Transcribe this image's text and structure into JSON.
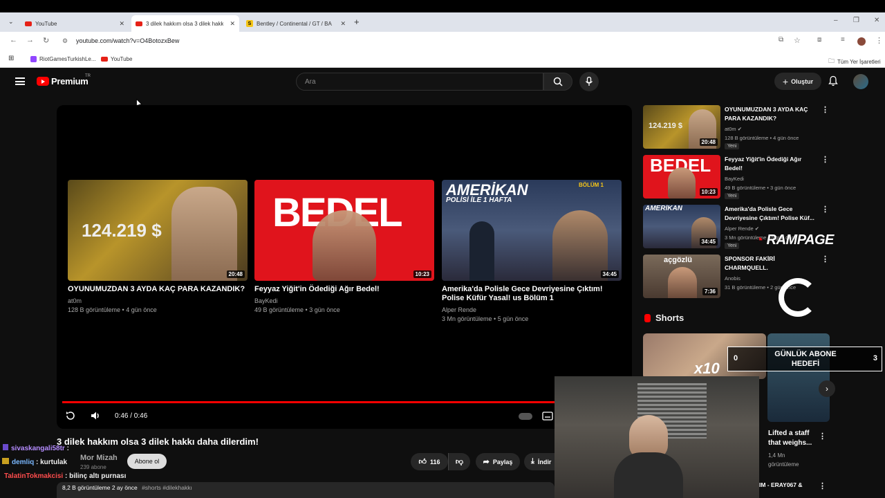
{
  "browser": {
    "tabs": [
      {
        "title": "YouTube"
      },
      {
        "title": "3 dilek hakkım olsa 3 dilek hakkı"
      },
      {
        "title": "Bentley / Continental / GT / BA"
      }
    ],
    "url": "youtube.com/watch?v=O4BotozxBew",
    "bookmarks": [
      "RiotGamesTurkishLe...",
      "YouTube"
    ],
    "all_bookmarks": "Tüm Yer İşaretleri"
  },
  "header": {
    "logo": "Premium",
    "country": "TR",
    "search_placeholder": "Ara",
    "create_label": "Oluştur"
  },
  "player": {
    "time": "0:46 / 0:46",
    "progress_fraction": 1.0,
    "end_cards": [
      {
        "title": "OYUNUMUZDAN 3 AYDA KAÇ PARA KAZANDIK?",
        "channel": "at0m",
        "meta": "128 B görüntüleme • 4 gün önce",
        "duration": "20:48",
        "thumb_text": "124.219 $"
      },
      {
        "title": "Feyyaz Yiğit'in Ödediği Ağır Bedel!",
        "channel": "BayKedi",
        "meta": "49 B görüntüleme • 3 gün önce",
        "duration": "10:23",
        "thumb_text": "BEDEL"
      },
      {
        "title": "Amerika'da Polisle Gece Devriyesine Çıktım! Polise Küfür Yasal! us Bölüm 1",
        "channel": "Alper Rende",
        "meta": "3 Mn görüntüleme • 5 gün önce",
        "duration": "34:45",
        "thumb_text": "AMERİKAN",
        "thumb_sub": "POLİSİ İLE 1 HAFTA",
        "thumb_badge": "BÖLÜM 1"
      }
    ]
  },
  "video": {
    "title": "3 dilek hakkım olsa 3 dilek hakkı daha dilerdim!",
    "channel": "Mor Mizah",
    "subscribers": "239 abone",
    "subscribe_label": "Abone ol",
    "likes": "116",
    "share_label": "Paylaş",
    "download_label": "İndir",
    "description_meta": "8,2 B görüntüleme  2 ay önce",
    "description_tags": "#shorts #dilekhakkı"
  },
  "chat": [
    {
      "user": "sivaskangali58tr",
      "message": ":"
    },
    {
      "user": "demliq",
      "message": ": kurtulak"
    },
    {
      "user": "TalatinTokmakcisi",
      "message": ": bilinç altı purnası"
    }
  ],
  "sidebar": {
    "items": [
      {
        "title": "OYUNUMUZDAN 3 AYDA KAÇ PARA KAZANDIK?",
        "channel": "at0m",
        "meta": "128 B görüntüleme • 4 gün önce",
        "badge": "Yeni",
        "duration": "20:48",
        "thumb_text": "124.219 $"
      },
      {
        "title": "Feyyaz Yiğit'in Ödediği Ağır Bedel!",
        "channel": "BayKedi",
        "meta": "49 B görüntüleme • 3 gün önce",
        "badge": "Yeni",
        "duration": "10:23",
        "thumb_text": "BEDEL"
      },
      {
        "title": "Amerika'da Polisle Gece Devriyesine Çıktım! Polise Küf...",
        "channel": "Alper Rende",
        "meta": "3 Mn görüntüleme • 5 gün önce",
        "badge": "Yeni",
        "duration": "34:45",
        "thumb_text": "AMERİKAN"
      },
      {
        "title": "SPONSOR FAKİRİ CHARMQUELL.",
        "channel": "Anobis",
        "meta": "31 B görüntüleme • 2 gün önce",
        "duration": "7:36",
        "thumb_text": "açgözlü"
      }
    ],
    "shorts_title": "Shorts",
    "short_item": {
      "title": "Lifted a staff that weighs...",
      "views": "1,4 Mn",
      "views_label": "görüntüleme"
    },
    "short_thumb_text": "x10",
    "partial_title": "IM - ERAY067 &"
  },
  "overlay": {
    "brand": "RAMPAGE",
    "goal_label": "GÜNLÜK ABONE HEDEFİ",
    "goal_current": "0",
    "goal_target": "3"
  }
}
